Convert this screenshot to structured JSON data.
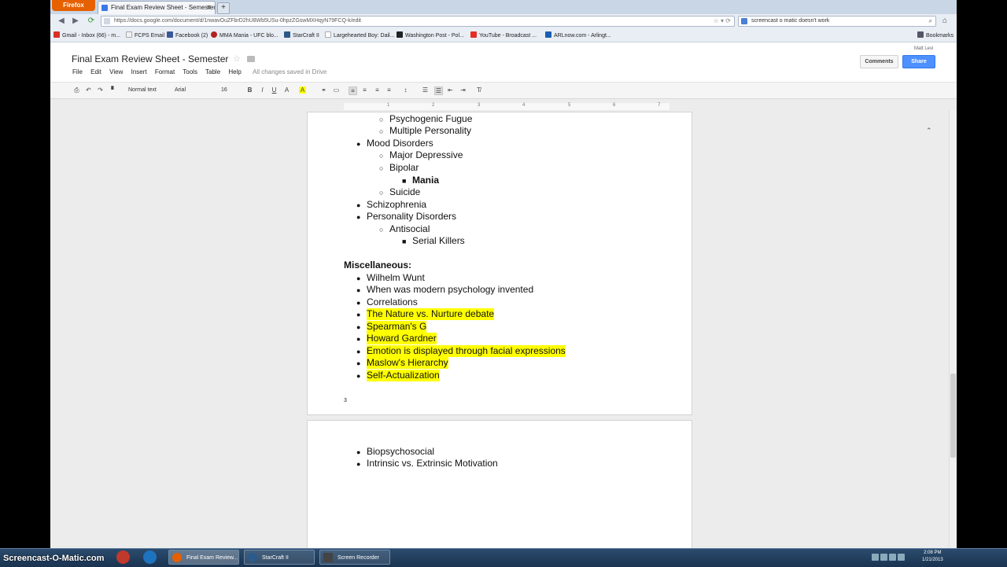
{
  "browser": {
    "firefox_label": "Firefox",
    "tab_title": "Final Exam Review Sheet - Semester - Go...",
    "new_tab_symbol": "+",
    "url": "https://docs.google.com/document/d/1nwavOuZFbrD2hU8Wb5USu-0hpzZGswMXHqyN79FCQ-k/edit",
    "search_text": "screencast o matic doesn't work",
    "bookmarks_label": "Bookmarks",
    "bookmarks": [
      {
        "label": "Gmail - Inbox (66) - m...",
        "color": "#d93025"
      },
      {
        "label": "FCPS Email",
        "color": "#f0f0f0"
      },
      {
        "label": "Facebook (2)",
        "color": "#3b5998"
      },
      {
        "label": "MMA Mania - UFC blo...",
        "color": "#b22222"
      },
      {
        "label": "StarCraft II",
        "color": "#2c5a8a"
      },
      {
        "label": "Largehearted Boy: Dail...",
        "color": "#ffffff"
      },
      {
        "label": "Washington Post - Pol...",
        "color": "#222222"
      },
      {
        "label": "YouTube - Broadcast ...",
        "color": "#e52d27"
      },
      {
        "label": "ARLnow.com - Arlingt...",
        "color": "#1a5fb4"
      }
    ]
  },
  "docs": {
    "title": "Final Exam Review Sheet - Semester",
    "user": "Matt Levi",
    "comments_label": "Comments",
    "share_label": "Share",
    "menu": [
      "File",
      "Edit",
      "View",
      "Insert",
      "Format",
      "Tools",
      "Table",
      "Help"
    ],
    "saved_status": "All changes saved in Drive",
    "toolbar": {
      "style": "Normal text",
      "font": "Arial",
      "size": "16"
    },
    "ruler_ticks": [
      "1",
      "2",
      "3",
      "4",
      "5",
      "6",
      "7"
    ],
    "page1": {
      "lines": [
        {
          "level": 2,
          "text": "Psychogenic Fugue"
        },
        {
          "level": 2,
          "text": "Multiple Personality"
        },
        {
          "level": 1,
          "text": "Mood Disorders"
        },
        {
          "level": 2,
          "text": "Major Depressive"
        },
        {
          "level": 2,
          "text": "Bipolar"
        },
        {
          "level": 3,
          "text": "Mania",
          "bold": true
        },
        {
          "level": 2,
          "text": "Suicide"
        },
        {
          "level": 1,
          "text": "Schizophrenia"
        },
        {
          "level": 1,
          "text": "Personality Disorders"
        },
        {
          "level": 2,
          "text": "Antisocial"
        },
        {
          "level": 3,
          "text": "Serial Killers"
        }
      ],
      "heading": "Miscellaneous:",
      "misc": [
        {
          "text": "Wilhelm Wunt",
          "highlight": false
        },
        {
          "text": "When was modern psychology invented",
          "highlight": false
        },
        {
          "text": "Correlations",
          "highlight": false
        },
        {
          "text": "The Nature vs. Nurture debate",
          "highlight": true
        },
        {
          "text": "Spearman's G",
          "highlight": true
        },
        {
          "text": "Howard Gardner",
          "highlight": true
        },
        {
          "text": "Emotion is displayed through facial expressions",
          "highlight": true
        },
        {
          "text": "Maslow's Hierarchy",
          "highlight": true
        },
        {
          "text": "Self-Actualization",
          "highlight": true
        }
      ],
      "page_number": "3"
    },
    "page2": {
      "lines": [
        {
          "text": "Biopsychosocial"
        },
        {
          "text": "Intrinsic vs. Extrinsic Motivation"
        }
      ]
    }
  },
  "taskbar": {
    "watermark": "Screencast-O-Matic.com",
    "tasks": [
      "Final Exam Review...",
      "StarCraft II",
      "Screen Recorder"
    ],
    "time": "2:08 PM",
    "date": "1/21/2013"
  },
  "colors": {
    "highlight": "#ffff00",
    "share_blue": "#4d90fe",
    "firefox_orange": "#e66000"
  }
}
